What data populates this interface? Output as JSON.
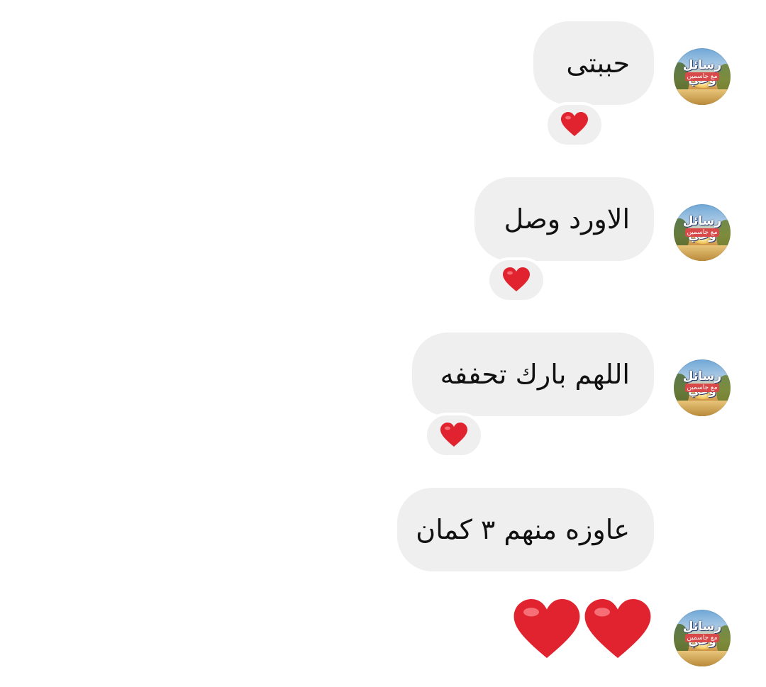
{
  "avatar": {
    "icon": "rasail-wa-logo-avatar",
    "logo_title": "رسائل وعي",
    "logo_subtitle": "مع جاسمين"
  },
  "messages": [
    {
      "text": "حببتى",
      "reaction": "❤️"
    },
    {
      "text": "الاورد وصل",
      "reaction": "❤️"
    },
    {
      "text": "اللهم بارك تحففه",
      "reaction": "❤️"
    },
    {
      "text": "عاوزه منهم ٣ كمان",
      "reaction": ""
    },
    {
      "text": "❤️❤️",
      "reaction": ""
    }
  ],
  "colors": {
    "bubble_bg": "#efefef",
    "heart_red": "#e0232e",
    "background": "#ffffff"
  }
}
